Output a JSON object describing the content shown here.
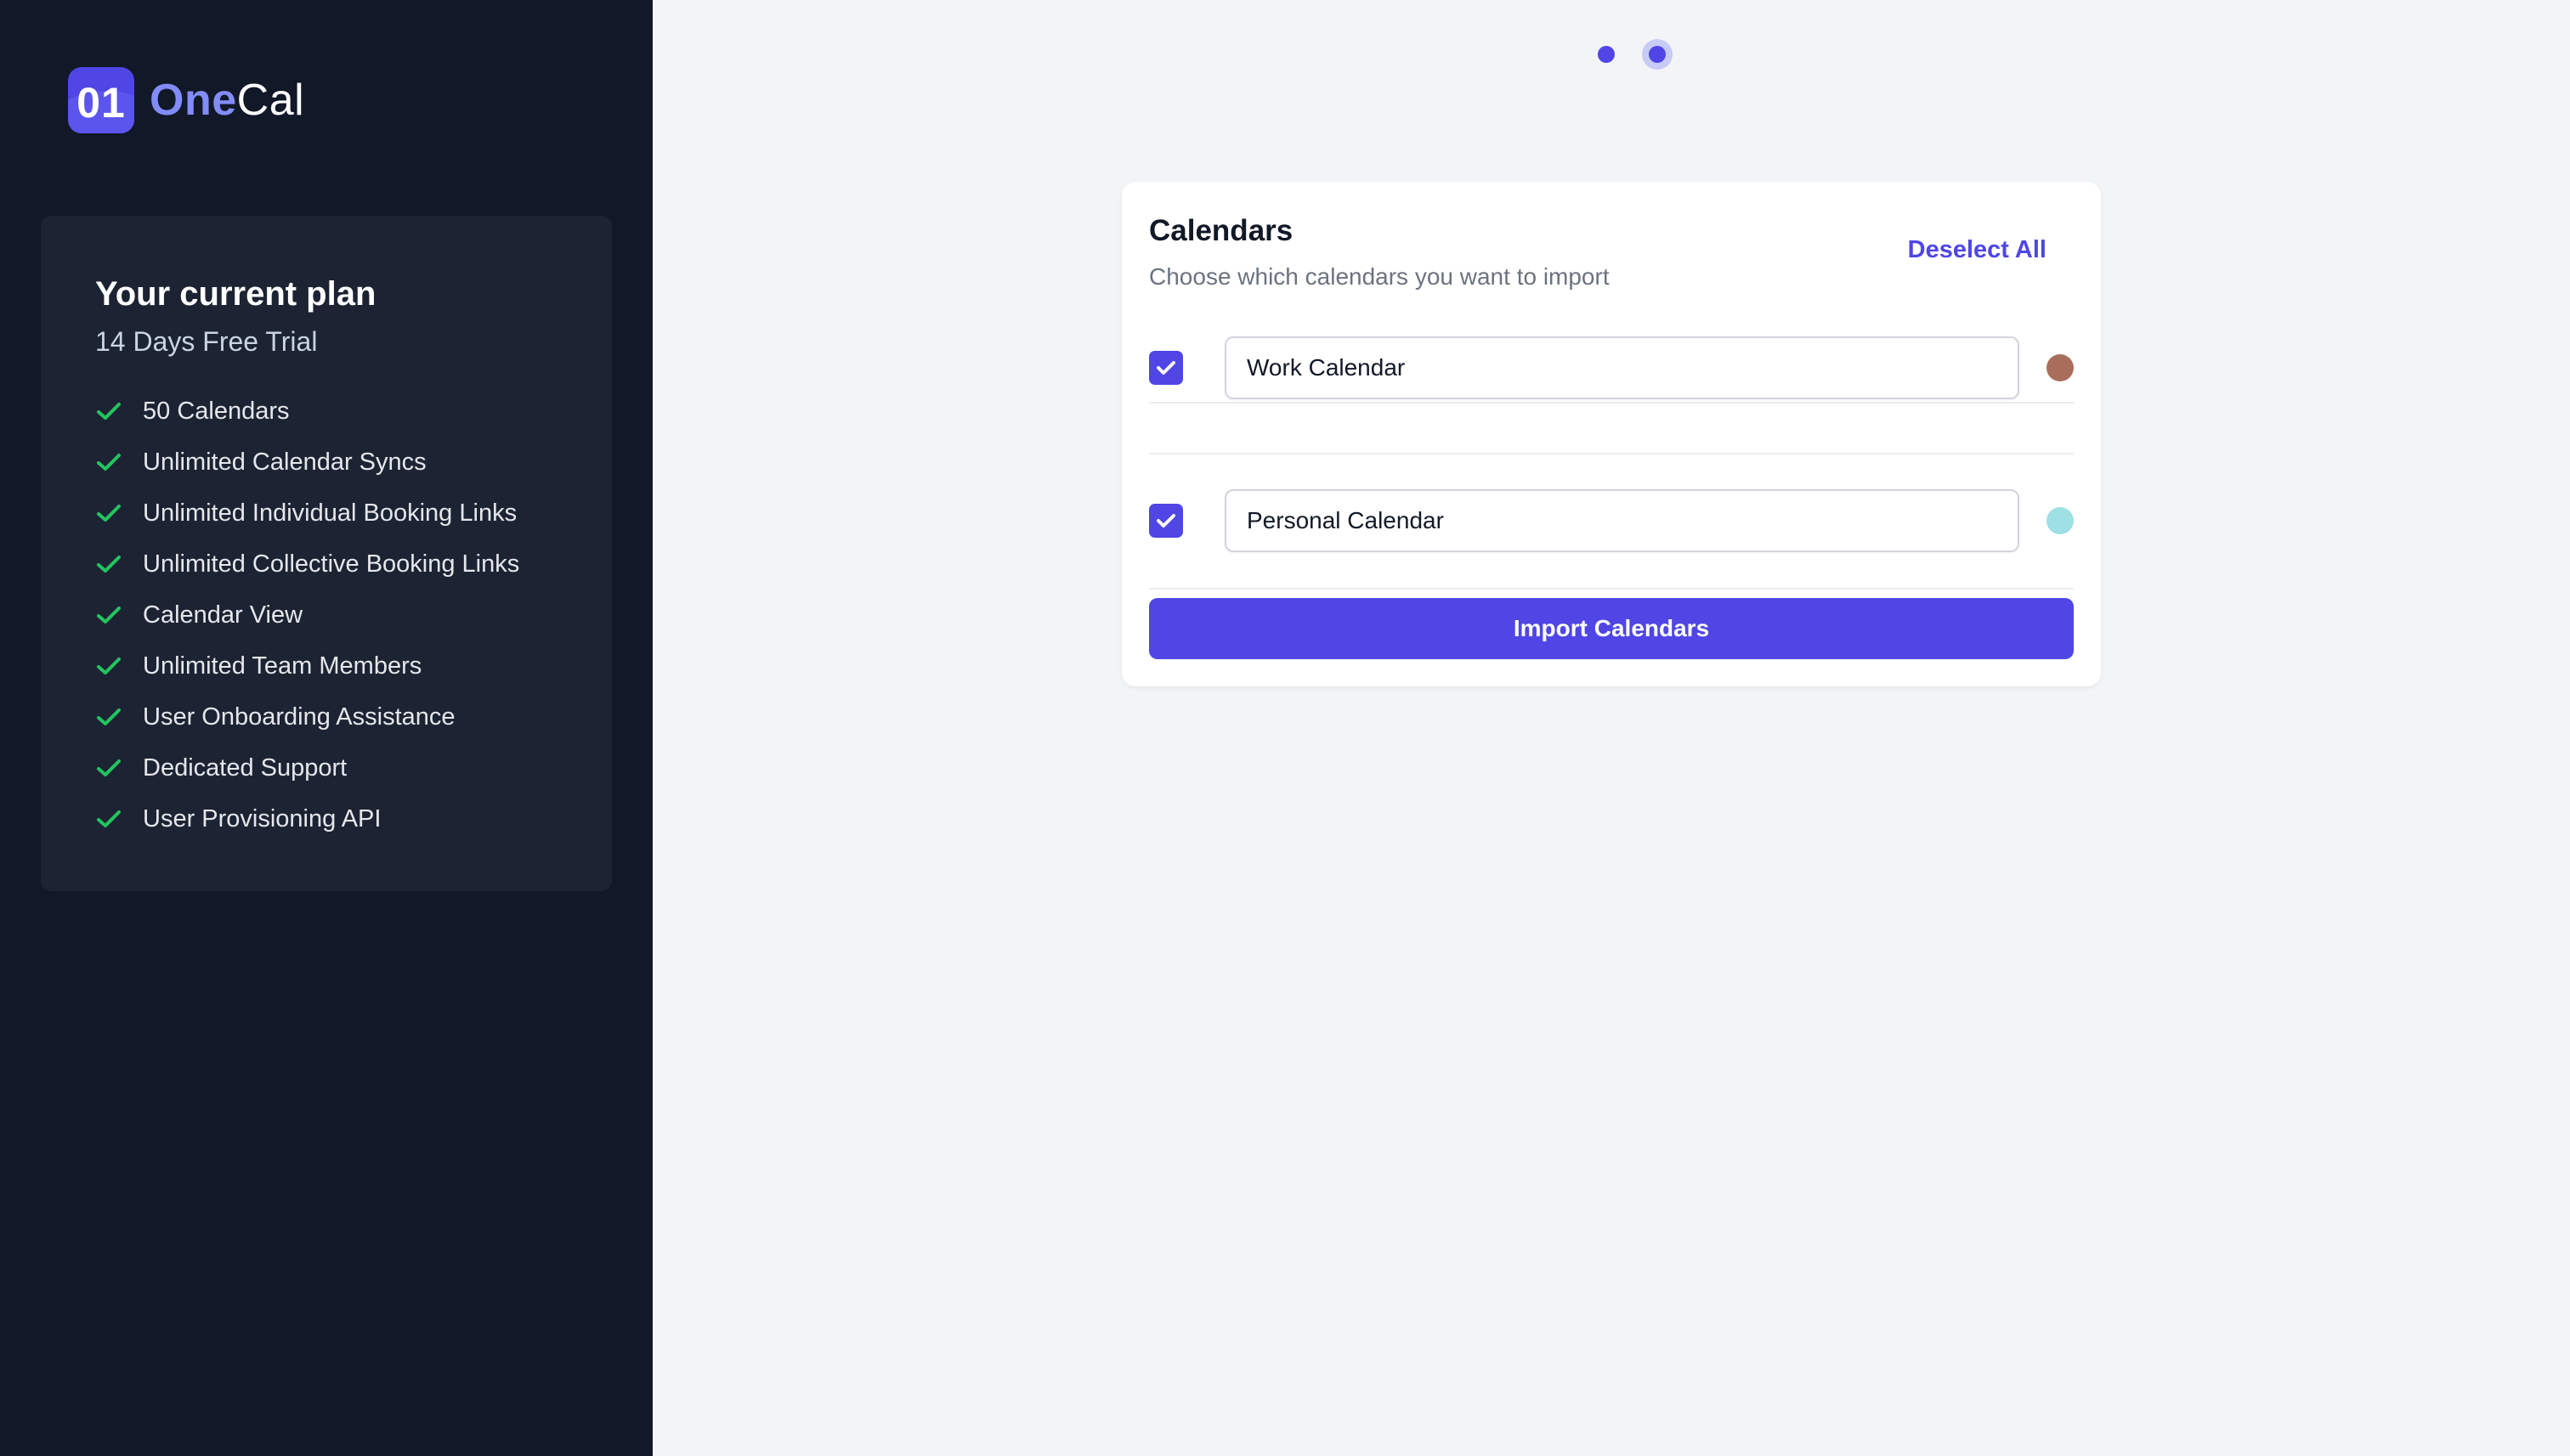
{
  "brand": {
    "icon_text": "01",
    "name_part1": "One",
    "name_part2": "Cal",
    "accent_color": "#4f46e5",
    "logo_light_color": "#818cf8"
  },
  "plan": {
    "title": "Your current plan",
    "subtitle": "14 Days Free Trial",
    "check_icon": "check-icon",
    "check_color": "#22c55e",
    "features": [
      "50 Calendars",
      "Unlimited Calendar Syncs",
      "Unlimited Individual Booking Links",
      "Unlimited Collective Booking Links",
      "Calendar View",
      "Unlimited Team Members",
      "User Onboarding Assistance",
      "Dedicated Support",
      "User Provisioning API"
    ]
  },
  "stepper": {
    "total_steps": 2,
    "current_step": 2
  },
  "calendars_card": {
    "title": "Calendars",
    "subtitle": "Choose which calendars you want to import",
    "deselect_label": "Deselect All",
    "items": [
      {
        "name": "Work Calendar",
        "checked": true,
        "color": "#a96e5b"
      },
      {
        "name": "Personal Calendar",
        "checked": true,
        "color": "#9ee0e3"
      }
    ],
    "import_label": "Import Calendars"
  }
}
